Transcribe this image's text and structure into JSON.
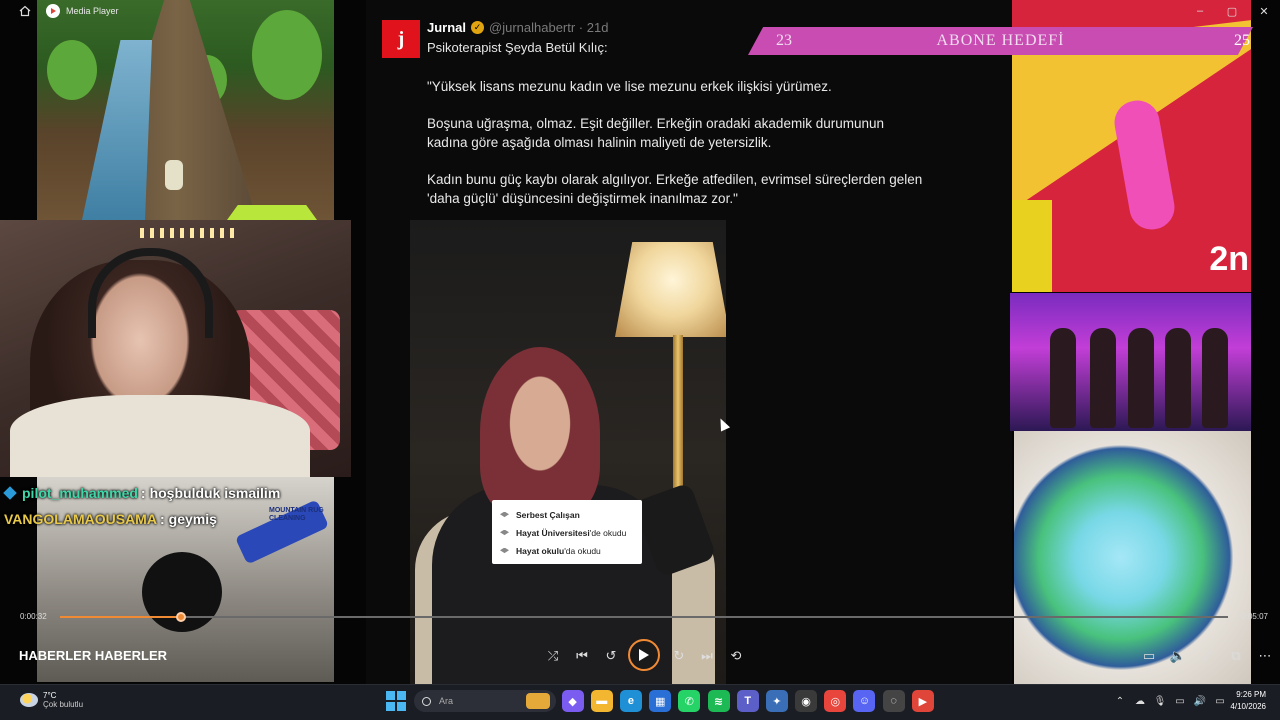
{
  "window": {
    "title": "Media Player",
    "controls": [
      "–",
      "▢",
      "✕"
    ]
  },
  "chat": {
    "messages": [
      {
        "user": "pilot_muhammed",
        "text": "hoşbulduk ismailim",
        "color": "#3fd6a8"
      },
      {
        "user": "VANGOLAMAOUSAMA",
        "text": "geymiş",
        "color": "#e8c94a"
      }
    ],
    "separator": ":"
  },
  "background_video_text": "MOUNTAIN RUG CLEANING",
  "tweet": {
    "avatar_letter": "j",
    "name": "Jurnal",
    "handle": "@jurnalhabertr · 21d",
    "subtitle": "Psikoterapist Şeyda Betül Kılıç:",
    "paragraphs": [
      "\"Yüksek lisans mezunu kadın ve lise mezunu erkek ilişkisi yürümez.",
      "Boşuna uğraşma, olmaz. Eşit değiller. Erkeğin oradaki akademik durumunun kadına göre aşağıda olması halinin maliyeti de yetersizlik.",
      "Kadın bunu güç kaybı olarak algılıyor. Erkeğe atfedilen, evrimsel süreçlerden gelen 'daha güçlü' düşüncesini değiştirmek inanılmaz zor.\""
    ]
  },
  "infobox": {
    "rows": [
      {
        "bold": "Serbest Çalışan",
        "rest": ""
      },
      {
        "bold": "Hayat Üniversitesi",
        "rest": "'de okudu"
      },
      {
        "bold": "Hayat okulu",
        "rest": "'da okudu"
      }
    ]
  },
  "goal": {
    "label": "ABONE HEDEFİ",
    "current": "23",
    "target": "25",
    "color": "#c94cb2"
  },
  "car_overlay_text": "2n",
  "player": {
    "current_time": "0:00:32",
    "duration": "0:05:07",
    "progress": 0.104,
    "video_title": "HABERLER HABERLER",
    "accent": "#f08a35"
  },
  "taskbar": {
    "weather_temp": "7°C",
    "weather_desc": "Çok bulutlu",
    "search_placeholder": "Ara",
    "time": "9:26 PM",
    "date": "4/10/2026",
    "apps": [
      {
        "name": "copilot-icon",
        "color": "#7b5cf0",
        "glyph": "◆"
      },
      {
        "name": "file-explorer-icon",
        "color": "#f2b630",
        "glyph": "▬"
      },
      {
        "name": "edge-icon",
        "color": "#1f8fd6",
        "glyph": "e"
      },
      {
        "name": "microsoft-store-icon",
        "color": "#2a6fd6",
        "glyph": "▦"
      },
      {
        "name": "whatsapp-icon",
        "color": "#25d366",
        "glyph": "✆"
      },
      {
        "name": "spotify-icon",
        "color": "#1db954",
        "glyph": "≋"
      },
      {
        "name": "teams-icon",
        "color": "#5b5fc7",
        "glyph": "T"
      },
      {
        "name": "app-gear-icon",
        "color": "#3a6fb8",
        "glyph": "✦"
      },
      {
        "name": "obs-icon",
        "color": "#3a3a3a",
        "glyph": "◉"
      },
      {
        "name": "chrome-icon",
        "color": "#e8453c",
        "glyph": "◎"
      },
      {
        "name": "discord-icon",
        "color": "#5865f2",
        "glyph": "☺"
      },
      {
        "name": "recorder-icon",
        "color": "#444444",
        "glyph": "◌"
      },
      {
        "name": "media-player-icon",
        "color": "#e0453a",
        "glyph": "▶"
      }
    ],
    "tray": [
      "⌃",
      "☁",
      "🎙",
      "▭",
      "🔊",
      "▭"
    ]
  }
}
